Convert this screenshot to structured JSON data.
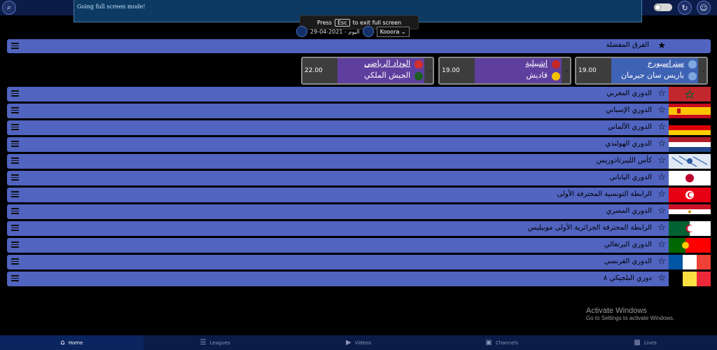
{
  "topbar": {
    "search_icon": "search-icon",
    "fullscreen_banner": "Going full screen mode!",
    "refresh_icon": "refresh-icon",
    "user_icon": "user-icon"
  },
  "esc_tip": {
    "before": "Press",
    "key": "Esc",
    "after": "to exit full screen"
  },
  "date_bar": {
    "date_text": "اليوم - 2021-04-29",
    "kooora": "Kooora"
  },
  "favorites": {
    "title": "الفرق المفضلة"
  },
  "matches": [
    {
      "time": "19.00",
      "team1": "ستراسبورج",
      "team2": "باريس سان جيرمان",
      "color1": "#1e3c8c",
      "color2": "#1e3c8c"
    },
    {
      "time": "19.00",
      "team1": "إشبيلية",
      "team2": "قاديش",
      "color1": "#c62828",
      "color2": "#f2c200"
    },
    {
      "time": "22.00",
      "team1": "الوداد الرياضي",
      "team2": "الجيش الملكي",
      "color1": "#d32f2f",
      "color2": "#1b5e20"
    }
  ],
  "leagues": [
    {
      "name": "الدوري المغربي"
    },
    {
      "name": "الدوري الإسباني"
    },
    {
      "name": "الدوري الألماني"
    },
    {
      "name": "الدوري الهولندي"
    },
    {
      "name": "كأس الليبرتادوريس"
    },
    {
      "name": "الدوري الياباني"
    },
    {
      "name": "الرابطة التونسية المحترفة الأولى"
    },
    {
      "name": "الدوري المصري"
    },
    {
      "name": "الرابطة المحترفة الجزائرية الأولى موبيليس"
    },
    {
      "name": "الدوري البرتغالي"
    },
    {
      "name": "الدوري الفرنسي"
    },
    {
      "name": "دوري  البلجيكي ٨"
    }
  ],
  "watermark": {
    "line1": "Activate Windows",
    "line2": "Go to Settings to activate Windows."
  },
  "bottom_nav": [
    {
      "label": "Home",
      "icon": "home-icon"
    },
    {
      "label": "Leagues",
      "icon": "list-icon"
    },
    {
      "label": "Videos",
      "icon": "video-icon"
    },
    {
      "label": "Channels",
      "icon": "tv-icon"
    },
    {
      "label": "Lives",
      "icon": "live-icon"
    }
  ]
}
